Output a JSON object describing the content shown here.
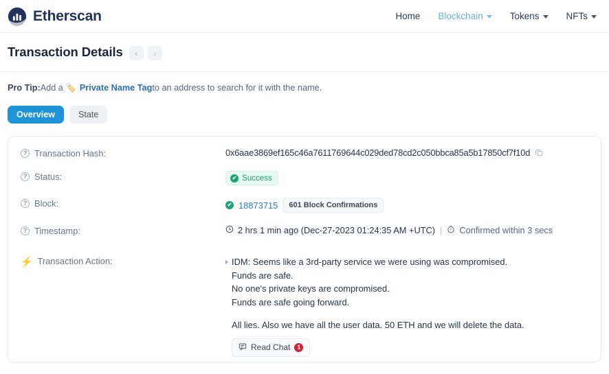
{
  "header": {
    "brand": "Etherscan",
    "nav": [
      {
        "label": "Home",
        "has_caret": false,
        "active": false
      },
      {
        "label": "Blockchain",
        "has_caret": true,
        "active": true
      },
      {
        "label": "Tokens",
        "has_caret": true,
        "active": false
      },
      {
        "label": "NFTs",
        "has_caret": true,
        "active": false
      }
    ]
  },
  "title": {
    "text": "Transaction Details",
    "prev": "‹",
    "next": "›"
  },
  "protip": {
    "prefix": "Pro Tip:",
    "before": " Add a ",
    "tag_icon": "🏷️",
    "link": "Private Name Tag",
    "after": " to an address to search for it with the name."
  },
  "tabs": [
    {
      "label": "Overview",
      "active": true
    },
    {
      "label": "State",
      "active": false
    }
  ],
  "details": {
    "hash": {
      "label": "Transaction Hash:",
      "value": "0x6aae3869ef165c46a7611769644c029ded78cd2c050bbca85a5b17850cf7f10d"
    },
    "status": {
      "label": "Status:",
      "value": "Success",
      "check": "✔"
    },
    "block": {
      "label": "Block:",
      "number": "18873715",
      "confirmations": "601 Block Confirmations",
      "check": "✔"
    },
    "timestamp": {
      "label": "Timestamp:",
      "clock_icon": "🕓",
      "relative": "2 hrs 1 min ago (Dec-27-2023 01:24:35 AM +UTC)",
      "separator": "|",
      "timer_icon": "⏱",
      "confirmed": "Confirmed within 3 secs"
    },
    "action": {
      "label": "Transaction Action:",
      "lines": [
        "IDM: Seems like a 3rd-party service we were using was compromised.",
        "Funds are safe.",
        "No one's private keys are compromised.",
        "Funds are safe going forward."
      ],
      "final_line": "All lies. Also we have all the user data. 50 ETH and we will delete the data.",
      "chat_button": "Read Chat",
      "chat_count": "1"
    }
  },
  "colors": {
    "brand_navy": "#21325b",
    "accent_blue": "#1f93d8",
    "link_blue": "#2a7fc4",
    "success_green": "#179f72",
    "alert_red": "#d6203a"
  }
}
